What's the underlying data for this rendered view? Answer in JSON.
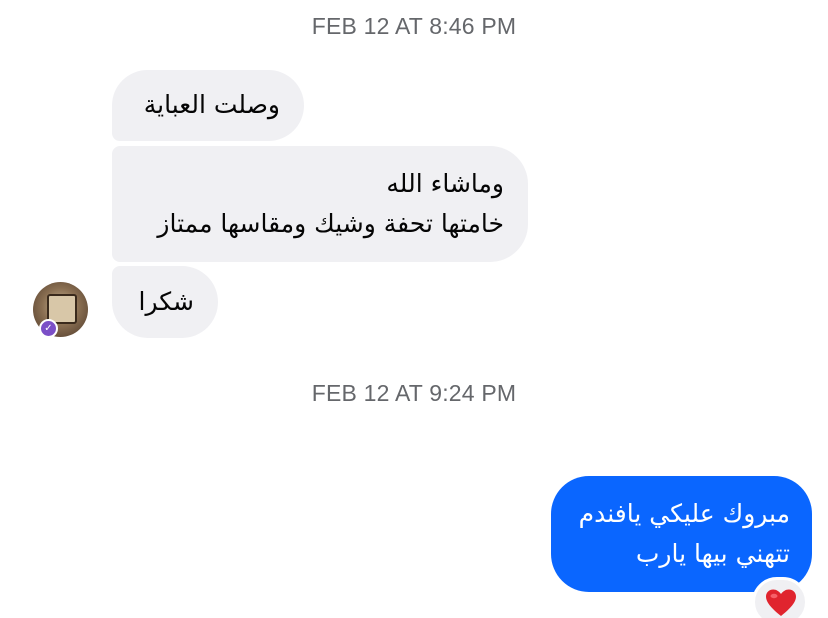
{
  "conversation": {
    "timestamps": [
      "FEB 12 AT 8:46 PM",
      "FEB 12 AT 9:24 PM"
    ],
    "incoming_messages": [
      "وصلت العباية",
      "وماشاء الله\nخامتها تحفة وشيك ومقاسها ممتاز",
      "شكرا"
    ],
    "outgoing_messages": [
      "مبروك عليكي يافندم\nتتهني بيها يارب"
    ],
    "reaction": {
      "icon": "red-heart-icon",
      "color": "#e0242e"
    }
  },
  "colors": {
    "incoming_bubble": "#f0f0f3",
    "outgoing_bubble": "#0a66ff",
    "timestamp_text": "#65676b"
  }
}
